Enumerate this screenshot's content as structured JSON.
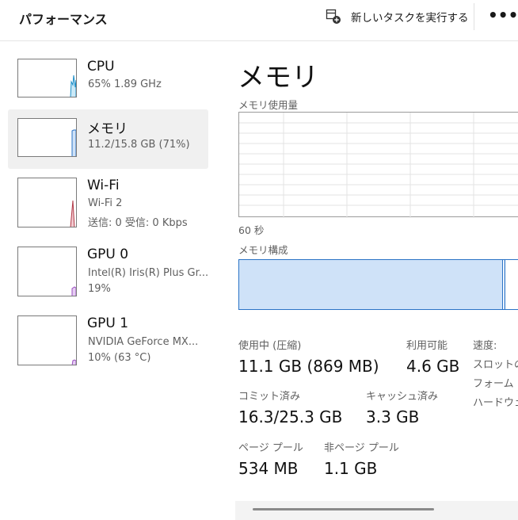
{
  "header": {
    "title": "パフォーマンス",
    "run_task_label": "新しいタスクを実行する",
    "more_label": "•••"
  },
  "sidebar": {
    "items": [
      {
        "title": "CPU",
        "line1": "65%  1.89 GHz",
        "line2": ""
      },
      {
        "title": "メモリ",
        "line1": "11.2/15.8 GB (71%)",
        "line2": ""
      },
      {
        "title": "Wi-Fi",
        "line1": "Wi-Fi 2",
        "line2": "送信: 0  受信: 0 Kbps"
      },
      {
        "title": "GPU 0",
        "line1": "Intel(R) Iris(R) Plus Gr...",
        "line2": "19%"
      },
      {
        "title": "GPU 1",
        "line1": "NVIDIA GeForce MX...",
        "line2": "10% (63 °C)"
      }
    ]
  },
  "main": {
    "title": "メモリ",
    "usage_label": "メモリ使用量",
    "time_label": "60 秒",
    "composition_label": "メモリ構成",
    "stats": {
      "in_use_label": "使用中 (圧縮)",
      "in_use_value": "11.1 GB (869 MB)",
      "available_label": "利用可能",
      "available_value": "4.6 GB",
      "committed_label": "コミット済み",
      "committed_value": "16.3/25.3 GB",
      "cached_label": "キャッシュ済み",
      "cached_value": "3.3 GB",
      "paged_label": "ページ プール",
      "paged_value": "534 MB",
      "nonpaged_label": "非ページ プール",
      "nonpaged_value": "1.1 GB"
    },
    "info": {
      "speed_label": "速度:",
      "slots_label": "スロットの使",
      "form_factor_label": "フォーム フ",
      "hw_reserved_label": "ハードウェア"
    }
  },
  "colors": {
    "cpu": "#1d8fc9",
    "memory": "#2b73c6",
    "wifi": "#b23a48",
    "gpu": "#9b4fc2",
    "memory_fill": "#cfe2f8"
  }
}
